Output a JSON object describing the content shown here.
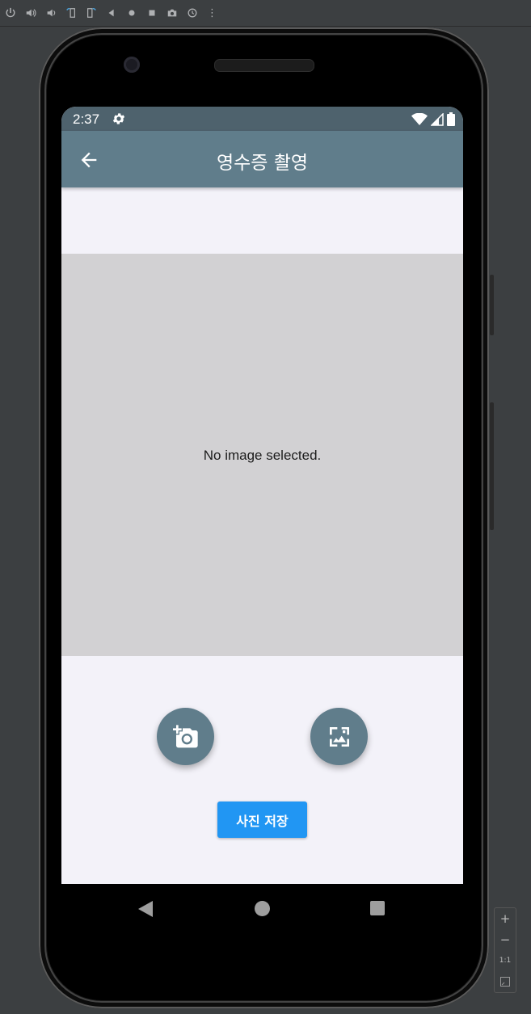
{
  "emulator_toolbar": {
    "buttons": [
      "power",
      "volume-up",
      "volume-down",
      "rotate-left",
      "rotate-right",
      "back",
      "home",
      "overview",
      "screenshot",
      "zoom-rotate",
      "more"
    ],
    "more_label": "⋮"
  },
  "status_bar": {
    "time": "2:37"
  },
  "app_bar": {
    "title": "영수증 촬영"
  },
  "image_preview": {
    "placeholder_text": "No image selected."
  },
  "actions": {
    "camera_icon": "add-a-photo-icon",
    "gallery_icon": "photo-size-select-icon",
    "save_label": "사진 저장"
  },
  "zoom_panel": {
    "plus": "+",
    "minus": "−",
    "actual": "1:1"
  },
  "colors": {
    "status_bar": "#4e626d",
    "app_bar": "#607d8b",
    "save_button": "#2196f3",
    "background": "#f3f2f9",
    "image_area": "#d2d1d3"
  }
}
